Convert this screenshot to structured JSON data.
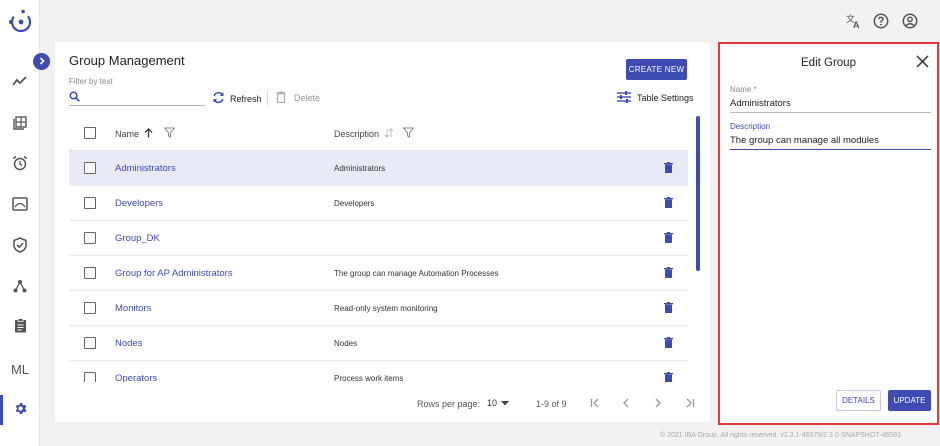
{
  "rail": {
    "ml_label": "ML",
    "items": [
      {
        "icon": "trend-chart-icon"
      },
      {
        "icon": "dashboard-icon"
      },
      {
        "icon": "alarm-clock-icon"
      },
      {
        "icon": "monitor-icon"
      },
      {
        "icon": "shield-check-icon"
      },
      {
        "icon": "hierarchy-icon"
      },
      {
        "icon": "clipboard-icon"
      },
      {
        "icon": "ml-label"
      },
      {
        "icon": "gear-icon",
        "active": true
      }
    ]
  },
  "topbar": {
    "icons": [
      "translate-icon",
      "help-icon",
      "account-icon"
    ]
  },
  "main": {
    "title": "Group Management",
    "filter_label": "Filter by text",
    "filter_value": "",
    "refresh_label": "Refresh",
    "delete_label": "Delete",
    "create_label": "CREATE NEW",
    "table_settings_label": "Table Settings",
    "columns": {
      "name": "Name",
      "description": "Description"
    },
    "rows": [
      {
        "name": "Administrators",
        "description": "Administrators",
        "selected": true
      },
      {
        "name": "Developers",
        "description": "Developers"
      },
      {
        "name": "Group_DK",
        "description": ""
      },
      {
        "name": "Group for AP Administrators",
        "description": "The group can manage Automation Processes"
      },
      {
        "name": "Monitors",
        "description": "Read-only system monitoring"
      },
      {
        "name": "Nodes",
        "description": "Nodes"
      },
      {
        "name": "Operators",
        "description": "Process work items"
      }
    ],
    "pager": {
      "rows_per_page_label": "Rows per page:",
      "rows_per_page": "10",
      "range": "1-9 of 9"
    }
  },
  "footer": "© 2021 IBA Group. All rights reserved. v2.3.1-46579/2.3.0-SNAPSHOT-46593",
  "edit_panel": {
    "title": "Edit Group",
    "name_label": "Name *",
    "name_value": "Administrators",
    "description_label": "Description",
    "description_value": "The group can manage all modules",
    "details_label": "DETAILS",
    "update_label": "UPDATE"
  },
  "colors": {
    "accent": "#3f4bb5",
    "highlight_border": "#e53935",
    "selected_row": "#e8eaf6"
  }
}
